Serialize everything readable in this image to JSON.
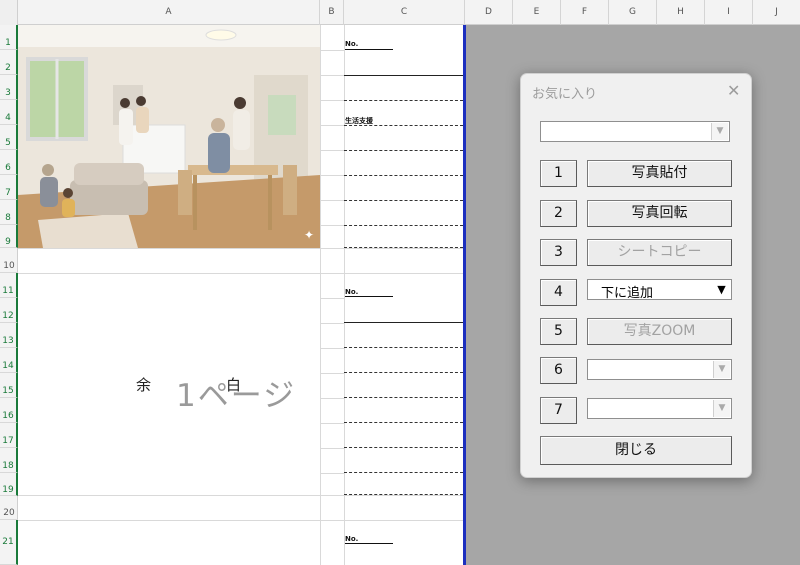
{
  "columns": [
    "A",
    "B",
    "C",
    "D",
    "E",
    "F",
    "G",
    "H",
    "I",
    "J"
  ],
  "rows": [
    "1",
    "2",
    "3",
    "4",
    "5",
    "6",
    "7",
    "8",
    "9",
    "10",
    "11",
    "12",
    "13",
    "14",
    "15",
    "16",
    "17",
    "18",
    "19",
    "20",
    "21"
  ],
  "sheet": {
    "no_label": "No.",
    "note_label": "生活支援",
    "blank_text": "余　白",
    "page_text": "1ページ"
  },
  "dialog": {
    "title": "お気に入り",
    "close": "✕",
    "top_combo_value": "",
    "buttons": [
      {
        "num": "1",
        "label": "写真貼付",
        "enabled": true
      },
      {
        "num": "2",
        "label": "写真回転",
        "enabled": true
      },
      {
        "num": "3",
        "label": "シートコピー",
        "enabled": false
      },
      {
        "num": "4",
        "label": "下に追加",
        "enabled": true
      },
      {
        "num": "5",
        "label": "写真ZOOM",
        "enabled": false
      },
      {
        "num": "6",
        "label": "",
        "enabled": true
      },
      {
        "num": "7",
        "label": "",
        "enabled": true
      }
    ],
    "close_button": "閉じる"
  },
  "icons": {
    "dropdown": "chevron-down-icon",
    "close": "close-icon"
  }
}
